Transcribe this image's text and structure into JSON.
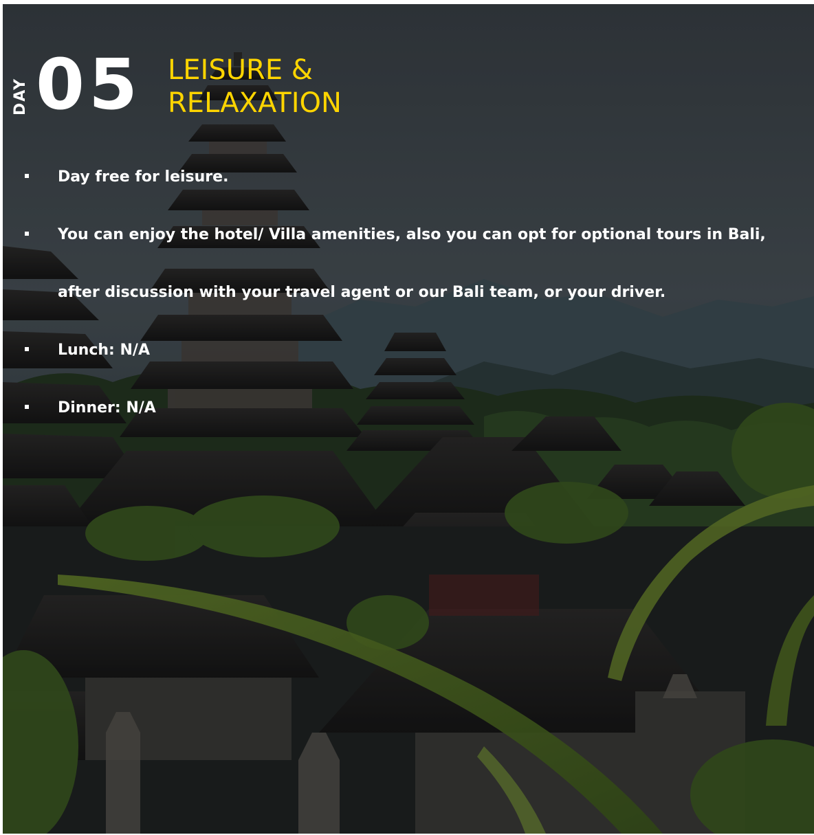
{
  "header": {
    "day_label": "DAY",
    "day_number": "05",
    "title_line1": "LEISURE &",
    "title_line2": "RELAXATION"
  },
  "activities": [
    {
      "text": "Day free for leisure."
    },
    {
      "text": "You can enjoy the hotel/ Villa amenities, also you can opt for optional tours in Bali, after discussion with your travel agent or our Bali team, or your driver."
    },
    {
      "text": "Lunch: N/A"
    },
    {
      "text": "Dinner: N/A"
    }
  ],
  "colors": {
    "title": "#ffd500",
    "text": "#ffffff",
    "background_tint": "#1a1d1e"
  },
  "background": {
    "icon": "bali-temple-pagoda-landscape"
  }
}
